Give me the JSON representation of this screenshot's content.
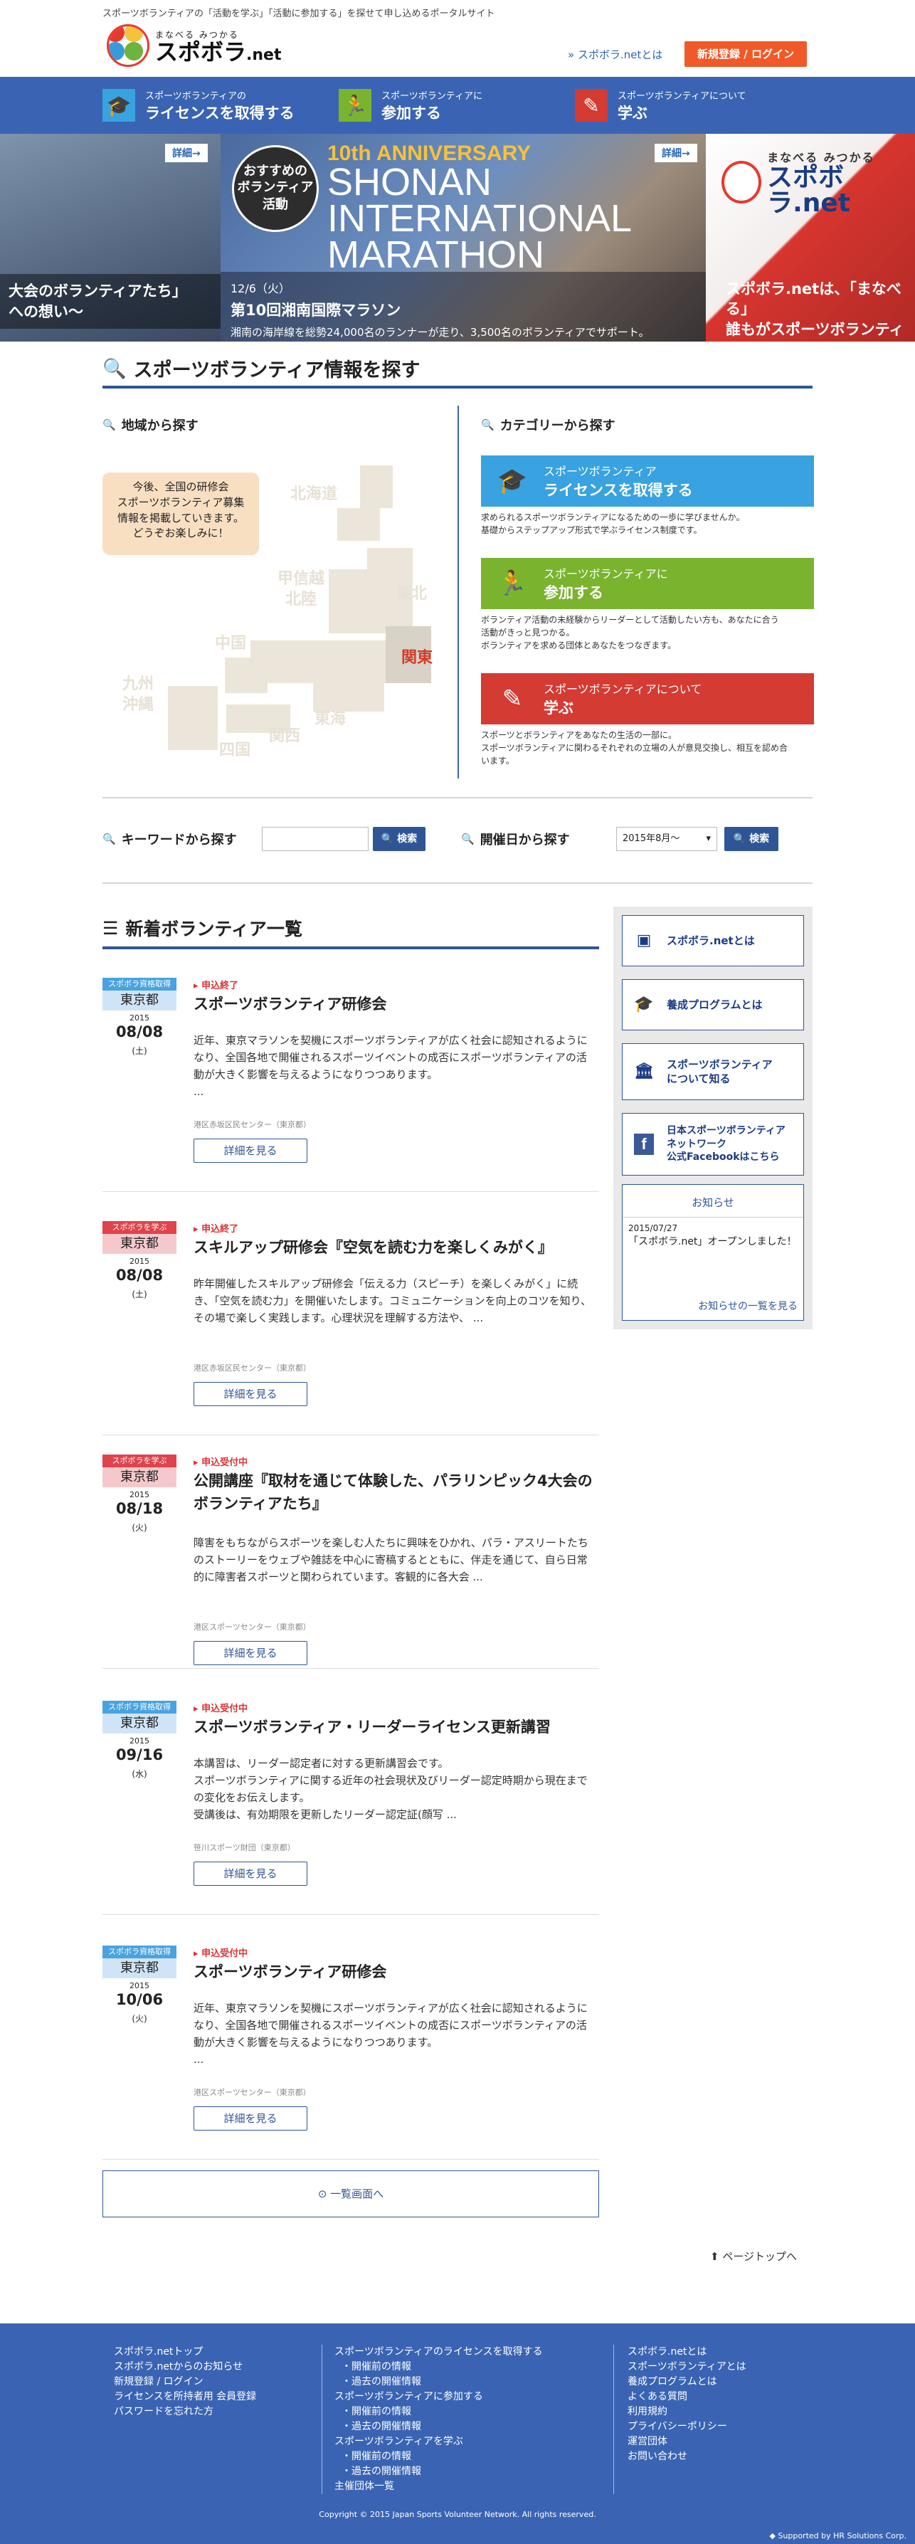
{
  "header": {
    "tagline": "スポーツボランティアの「活動を学ぶ」「活動に参加する」を探せて申し込めるポータルサイト",
    "logo_sub": "まなべる みつかる",
    "logo_name": "スポボラ",
    "logo_suffix": ".net",
    "about_link": "» スポボラ.netとは",
    "register": "新規登録 / ログイン"
  },
  "nav": [
    {
      "line1": "スポーツボランティアの",
      "line2": "ライセンスを取得する",
      "icon": "graduation-cap-icon"
    },
    {
      "line1": "スポーツボランティアに",
      "line2": "参加する",
      "icon": "runner-icon"
    },
    {
      "line1": "スポーツボランティアについて",
      "line2": "学ぶ",
      "icon": "pencil-icon"
    }
  ],
  "hero": {
    "left_caption": "大会のボランティアたち」\nへの想い～",
    "detail": "詳細→",
    "badge": "おすすめの\nボランティア\n活動",
    "en_line1": "10th ANNIVERSARY",
    "en_line2": "SHONAN",
    "en_line3": "INTERNATIONAL",
    "en_line4": "MARATHON",
    "date": "12/6（火）",
    "title": "第10回湘南国際マラソン",
    "sub": "湘南の海岸線を総勢24,000名のランナーが走り、3,500名のボランティアでサポート。",
    "right_logo_sub": "まなべる みつかる",
    "right_logo_name": "スポボラ.net",
    "right_caption": "スポボラ.netは、「まなべる」\n誰もがスポーツボランティアに"
  },
  "search": {
    "title": "スポーツボランティア情報を探す",
    "region_title": "地域から探す",
    "map_note": "今後、全国の研修会\nスポーツボランティア募集\n情報を掲載していきます。\nどうぞお楽しみに！",
    "regions": {
      "hokkaido": "北海道",
      "tohoku": "東北",
      "koshinetsu": "甲信越\n北陸",
      "kanto": "関東",
      "chugoku": "中国",
      "kyushu": "九州\n沖縄",
      "tokai": "東海",
      "kansai": "関西",
      "shikoku": "四国"
    },
    "category_title": "カテゴリーから探す",
    "categories": [
      {
        "line1": "スポーツボランティア",
        "line2": "ライセンスを取得する",
        "desc": "求められるスポーツボランティアになるための一歩に学びませんか。\n基礎からステップアップ形式で学ぶライセンス制度です。",
        "color": "#39a2e0"
      },
      {
        "line1": "スポーツボランティアに",
        "line2": "参加する",
        "desc": "ボランティア活動の未経験からリーダーとして活動したい方も、あなたに合う\n活動がきっと見つかる。\nボランティアを求める団体とあなたをつなぎます。",
        "color": "#7ab32e"
      },
      {
        "line1": "スポーツボランティアについて",
        "line2": "学ぶ",
        "desc": "スポーツとボランティアをあなたの生活の一部に。\nスポーツボランティアに関わるそれぞれの立場の人が意見交換し、相互を認め合\nいます。",
        "color": "#d43b33"
      }
    ],
    "keyword_label": "キーワードから探す",
    "keyword_placeholder": "",
    "search_btn": "検索",
    "date_label": "開催日から探す",
    "date_value": "2015年8月〜"
  },
  "list": {
    "title": "新着ボランティア一覧",
    "items": [
      {
        "badge": "スポボラ資格取得",
        "badge_color": "#4aa3e0",
        "area_bg": "#cfe5f7",
        "area": "東京都",
        "year": "2015",
        "md": "08/08",
        "dow": "(土)",
        "status": "申込終了",
        "title": "スポーツボランティア研修会",
        "body": "近年、東京マラソンを契機にスポーツボランティアが広く社会に認知されるようになり、全国各地で開催されるスポーツイベントの成否にスポーツボランティアの活動が大きく影響を与えるようになりつつあります。\n...",
        "org": "港区赤坂区民センター（東京都）",
        "more": "詳細を見る"
      },
      {
        "badge": "スポボラを学ぶ",
        "badge_color": "#e0434b",
        "area_bg": "#f5c9cb",
        "area": "東京都",
        "year": "2015",
        "md": "08/08",
        "dow": "(土)",
        "status": "申込終了",
        "title": "スキルアップ研修会『空気を読む力を楽しくみがく』",
        "body": "昨年開催したスキルアップ研修会「伝える力（スピーチ）を楽しくみがく」に続き、「空気を読む力」を開催いたします。コミュニケーションを向上のコツを知り、その場で楽しく実践します。心理状況を理解する方法や、 ...",
        "org": "港区赤坂区民センター（東京都）",
        "more": "詳細を見る"
      },
      {
        "badge": "スポボラを学ぶ",
        "badge_color": "#e0434b",
        "area_bg": "#f5c9cb",
        "area": "東京都",
        "year": "2015",
        "md": "08/18",
        "dow": "(火)",
        "status": "申込受付中",
        "title": "公開講座『取材を通じて体験した、パラリンピック4大会の\nボランティアたち』",
        "body": "障害をもちながらスポーツを楽しむ人たちに興味をひかれ、パラ・アスリートたちのストーリーをウェブや雑誌を中心に寄稿するとともに、伴走を通じて、自ら日常的に障害者スポーツと関わられています。客観的に各大会 ...",
        "org": "港区スポーツセンター（東京都）",
        "more": "詳細を見る"
      },
      {
        "badge": "スポボラ資格取得",
        "badge_color": "#4aa3e0",
        "area_bg": "#cfe5f7",
        "area": "東京都",
        "year": "2015",
        "md": "09/16",
        "dow": "(水)",
        "status": "申込受付中",
        "title": "スポーツボランティア・リーダーライセンス更新講習",
        "body": "本講習は、リーダー認定者に対する更新講習会です。\nスポーツボランティアに関する近年の社会現状及びリーダー認定時期から現在までの変化をお伝えします。\n受講後は、有効期限を更新したリーダー認定証(顔写 ...",
        "org": "笹川スポーツ財団（東京都）",
        "more": "詳細を見る"
      },
      {
        "badge": "スポボラ資格取得",
        "badge_color": "#4aa3e0",
        "area_bg": "#cfe5f7",
        "area": "東京都",
        "year": "2015",
        "md": "10/06",
        "dow": "(火)",
        "status": "申込受付中",
        "title": "スポーツボランティア研修会",
        "body": "近年、東京マラソンを契機にスポーツボランティアが広く社会に認知されるようになり、全国各地で開催されるスポーツイベントの成否にスポーツボランティアの活動が大きく影響を与えるようになりつつあります。\n...",
        "org": "港区スポーツセンター（東京都）",
        "more": "詳細を見る"
      }
    ],
    "back": "一覧画面へ",
    "page_top": "ページトップへ"
  },
  "sidebar": {
    "buttons": [
      "スポボラ.netとは",
      "養成プログラムとは",
      "スポーツボランティア\nについて知る",
      "日本スポーツボランティア\nネットワーク\n公式Facebookはこちら"
    ],
    "news_title": "お知らせ",
    "news_date": "2015/07/27",
    "news_text": "「スポボラ.net」オープンしました！",
    "news_more": "お知らせの一覧を見る"
  },
  "footer": {
    "col1": [
      "スポボラ.netトップ",
      "スポボラ.netからのお知らせ",
      "新規登録 / ログイン",
      "ライセンスを所持者用 会員登録",
      "パスワードを忘れた方"
    ],
    "col2": [
      {
        "t": "スポーツボランティアのライセンスを取得する",
        "sub": false
      },
      {
        "t": "・開催前の情報",
        "sub": true
      },
      {
        "t": "・過去の開催情報",
        "sub": true
      },
      {
        "t": "スポーツボランティアに参加する",
        "sub": false
      },
      {
        "t": "・開催前の情報",
        "sub": true
      },
      {
        "t": "・過去の開催情報",
        "sub": true
      },
      {
        "t": "スポーツボランティアを学ぶ",
        "sub": false
      },
      {
        "t": "・開催前の情報",
        "sub": true
      },
      {
        "t": "・過去の開催情報",
        "sub": true
      },
      {
        "t": "主催団体一覧",
        "sub": false
      }
    ],
    "col3": [
      "スポボラ.netとは",
      "スポーツボランティアとは",
      "養成プログラムとは",
      "よくある質問",
      "利用規約",
      "プライバシーポリシー",
      "運営団体",
      "お問い合わせ"
    ],
    "copyright": "Copyright © 2015 Japan Sports Volunteer Network. All rights reserved.",
    "supported": "◆ Supported by HR Solutions Corp."
  }
}
